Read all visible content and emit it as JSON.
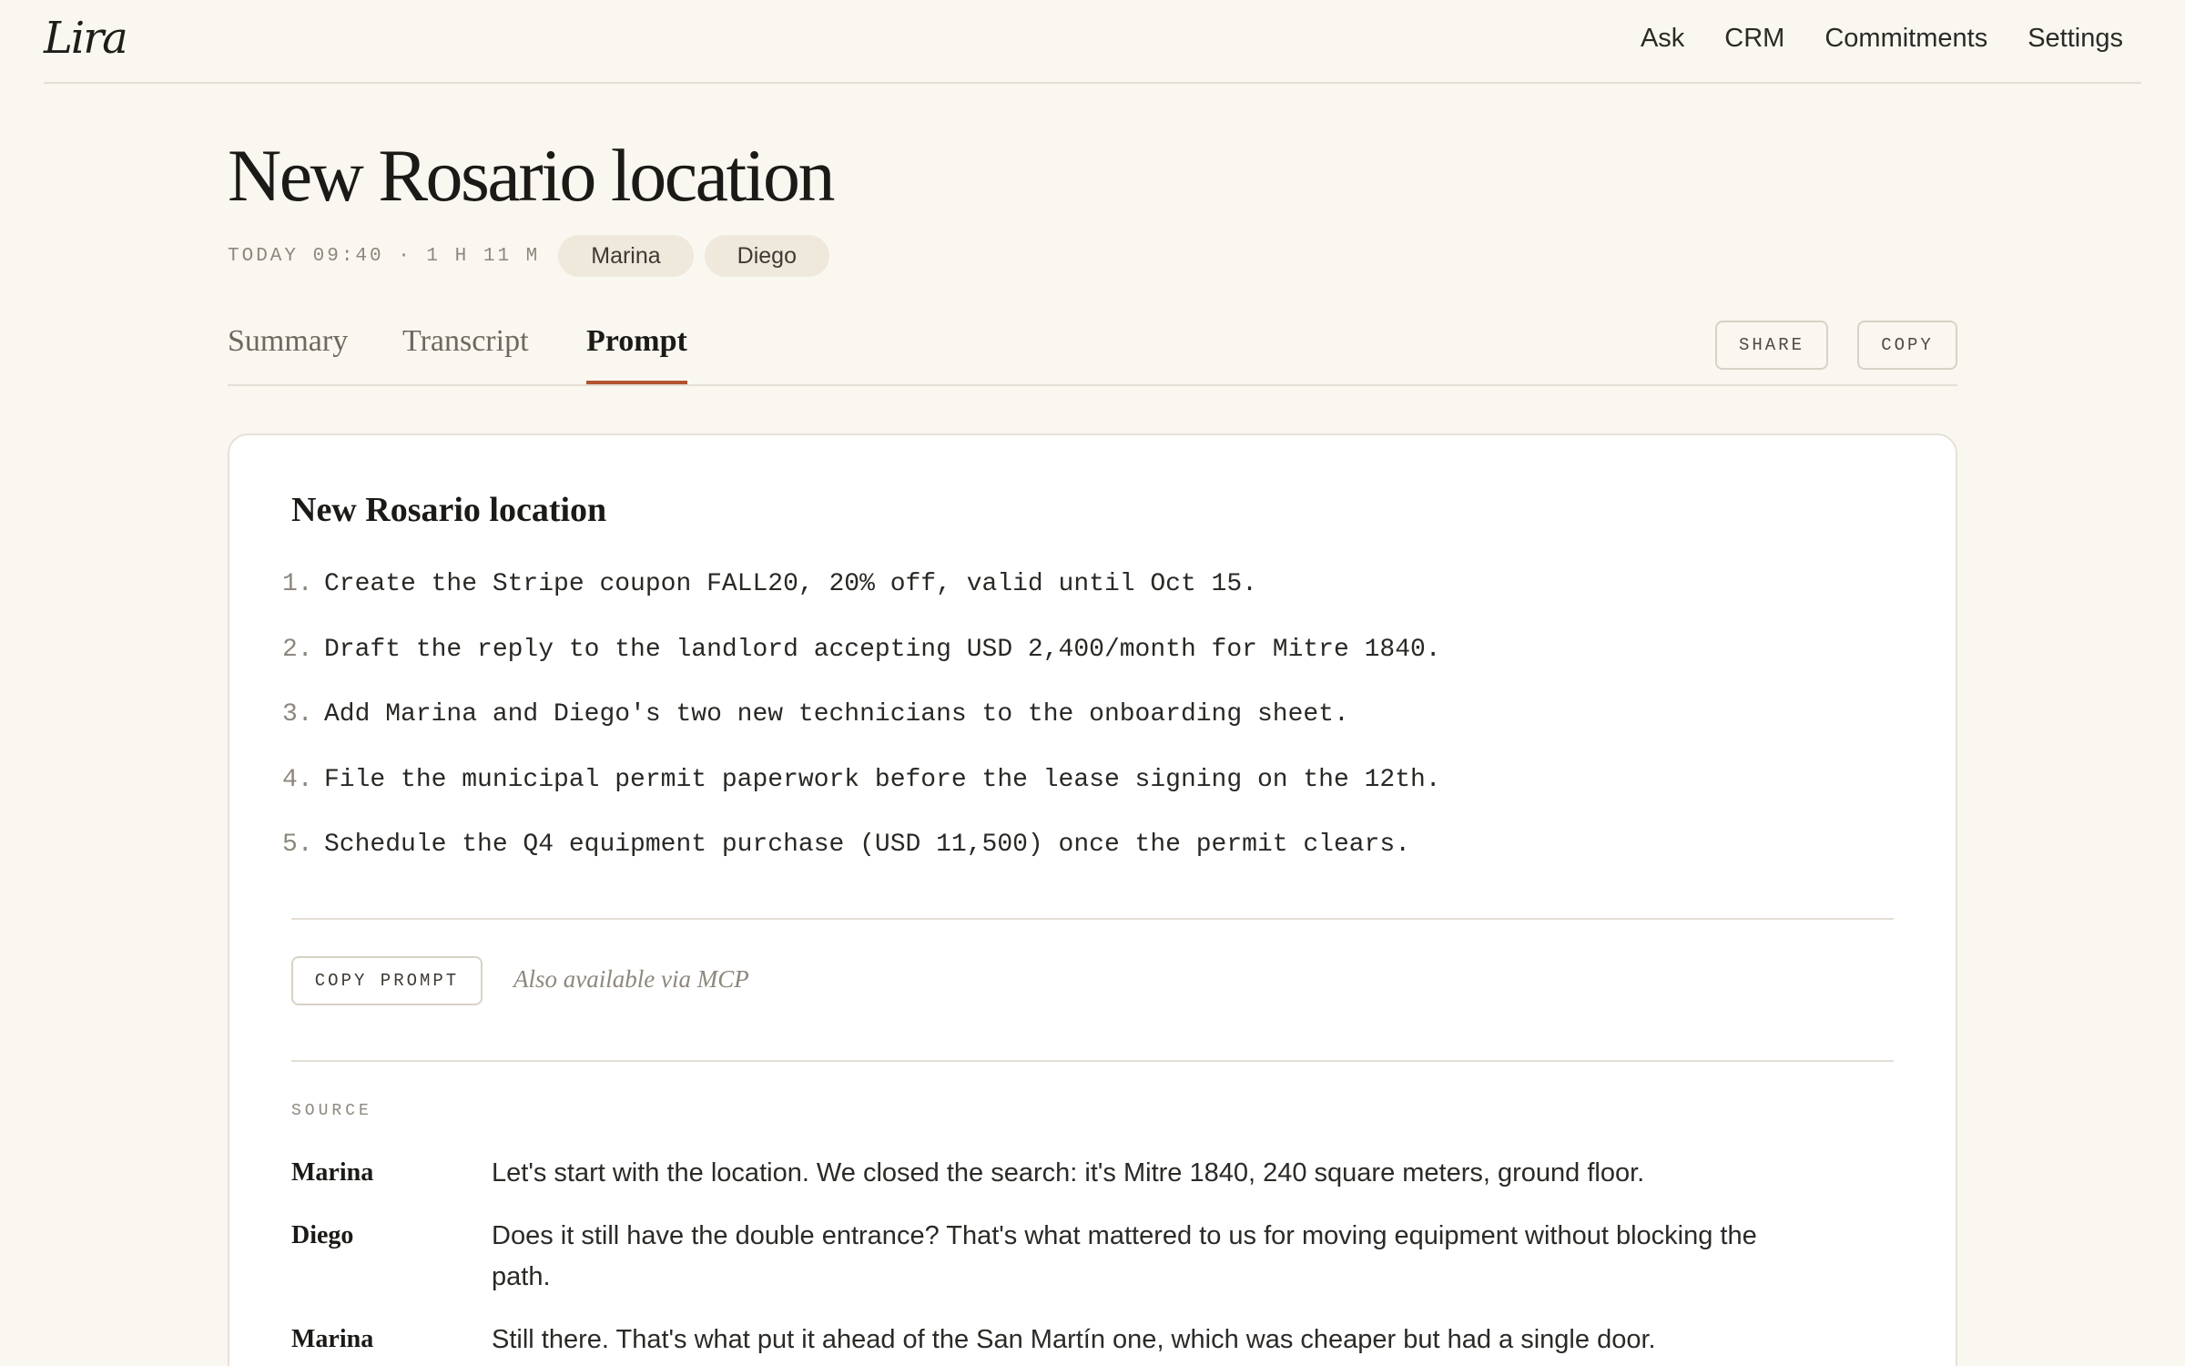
{
  "app": {
    "logo": "Lira"
  },
  "nav": {
    "items": [
      "Ask",
      "CRM",
      "Commitments",
      "Settings"
    ]
  },
  "meeting": {
    "title": "New Rosario location",
    "meta": "TODAY 09:40 · 1 H 11 M",
    "participants": [
      "Marina",
      "Diego"
    ]
  },
  "tabs": {
    "items": [
      "Summary",
      "Transcript",
      "Prompt"
    ],
    "active": "Prompt"
  },
  "actions": {
    "share_label": "SHARE",
    "copy_label": "COPY"
  },
  "prompt_card": {
    "title": "New Rosario location",
    "steps": [
      {
        "num": "1.",
        "text": "Create the Stripe coupon FALL20, 20% off, valid until Oct 15."
      },
      {
        "num": "2.",
        "text": "Draft the reply to the landlord accepting USD 2,400/month for Mitre 1840."
      },
      {
        "num": "3.",
        "text": "Add Marina and Diego's two new technicians to the onboarding sheet."
      },
      {
        "num": "4.",
        "text": "File the municipal permit paperwork before the lease signing on the 12th."
      },
      {
        "num": "5.",
        "text": "Schedule the Q4 equipment purchase (USD 11,500) once the permit clears."
      }
    ],
    "copy_prompt_label": "COPY PROMPT",
    "mcp_note": "Also available via MCP",
    "source_label": "SOURCE",
    "source": [
      {
        "speaker": "Marina",
        "text": "Let's start with the location. We closed the search: it's Mitre 1840, 240 square meters, ground floor."
      },
      {
        "speaker": "Diego",
        "text": "Does it still have the double entrance? That's what mattered to us for moving equipment without blocking the path."
      },
      {
        "speaker": "Marina",
        "text": "Still there. That's what put it ahead of the San Martín one, which was cheaper but had a single door."
      }
    ]
  },
  "colors": {
    "background": "#faf7f1",
    "accent": "#b2542f",
    "chip": "#efe9dc",
    "card": "#ffffff"
  }
}
